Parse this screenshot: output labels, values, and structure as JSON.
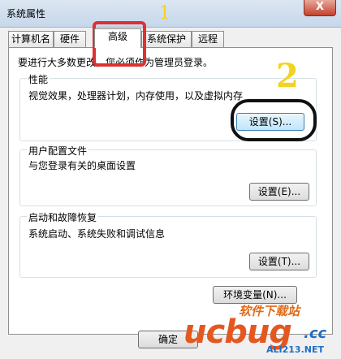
{
  "window": {
    "title": "系统属性",
    "close": "X"
  },
  "tabs": [
    {
      "label": "计算机名"
    },
    {
      "label": "硬件"
    },
    {
      "label": "高级"
    },
    {
      "label": "系统保护"
    },
    {
      "label": "远程"
    }
  ],
  "notice": "要进行大多数更改，您必须作为管理员登录。",
  "groups": {
    "performance": {
      "title": "性能",
      "desc": "视觉效果，处理器计划，内存使用，以及虚拟内存",
      "button": "设置(S)..."
    },
    "profiles": {
      "title": "用户配置文件",
      "desc": "与您登录有关的桌面设置",
      "button": "设置(E)..."
    },
    "startup": {
      "title": "启动和故障恢复",
      "desc": "系统启动、系统失败和调试信息",
      "button": "设置(T)..."
    }
  },
  "env_button": "环境变量(N)...",
  "ok_button": "确定",
  "annotations": {
    "one": "1",
    "two": "2"
  },
  "watermark": {
    "line1": "软件下载站",
    "logo": "ucbug",
    "tld": ".cc",
    "domain": "ALI213.NET"
  },
  "colors": {
    "annot_red": "#e03030",
    "annot_yellow": "#f2d321",
    "annot_black": "#111111"
  }
}
